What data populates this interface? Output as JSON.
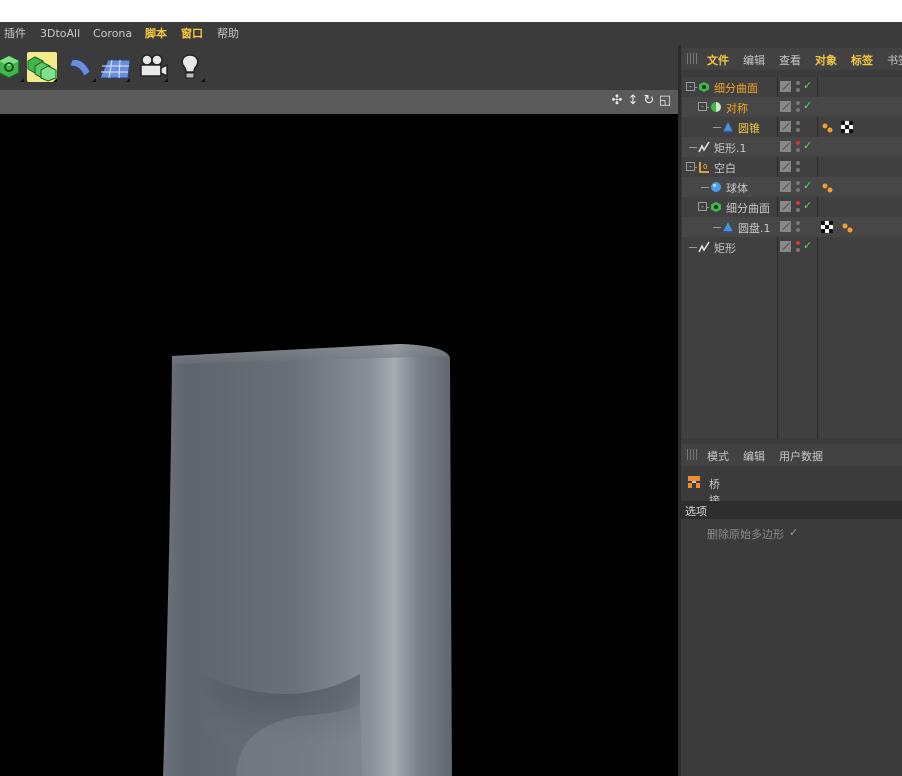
{
  "menubar": {
    "items": [
      {
        "label": "插件",
        "highlight": false
      },
      {
        "label": "3DtoAll",
        "highlight": false
      },
      {
        "label": "Corona",
        "highlight": false
      },
      {
        "label": "脚本",
        "highlight": true
      },
      {
        "label": "窗口",
        "highlight": true
      },
      {
        "label": "帮助",
        "highlight": false
      }
    ]
  },
  "toolbar": {
    "buttons": [
      {
        "icon": "subdivision-cube-icon"
      },
      {
        "icon": "array-cubes-icon",
        "active": true
      },
      {
        "icon": "bend-deformer-icon"
      },
      {
        "icon": "floor-plane-icon"
      },
      {
        "icon": "camera-icon"
      },
      {
        "icon": "light-bulb-icon"
      }
    ]
  },
  "viewport": {
    "header_icons": [
      "move-view-icon",
      "zoom-view-icon",
      "rotate-view-icon",
      "maximize-view-icon"
    ],
    "background": "#000000"
  },
  "object_manager": {
    "menus": [
      {
        "label": "文件",
        "highlight": true
      },
      {
        "label": "编辑",
        "highlight": false
      },
      {
        "label": "查看",
        "highlight": false
      },
      {
        "label": "对象",
        "highlight": true
      },
      {
        "label": "标签",
        "highlight": true
      },
      {
        "label": "书签",
        "highlight": false
      }
    ],
    "rows": [
      {
        "name": "细分曲面",
        "icon": "subdivision-surface-icon",
        "style": "sel",
        "check": true,
        "dot_red": false,
        "tags": []
      },
      {
        "name": "对称",
        "icon": "symmetry-icon",
        "style": "sel",
        "check": true,
        "dot_red": false,
        "tags": []
      },
      {
        "name": "圆锥",
        "icon": "cone-icon",
        "style": "sel2",
        "check": false,
        "dot_red": false,
        "tags": [
          "phong-tag-icon",
          "checker-tag-icon"
        ]
      },
      {
        "name": "矩形.1",
        "icon": "spline-icon",
        "style": "",
        "check": true,
        "dot_red": true,
        "tags": []
      },
      {
        "name": "空白",
        "icon": "null-icon",
        "style": "",
        "check": false,
        "dot_red": false,
        "tags": []
      },
      {
        "name": "球体",
        "icon": "sphere-icon",
        "style": "",
        "check": true,
        "dot_red": false,
        "tags": [
          "phong-tag-icon"
        ]
      },
      {
        "name": "细分曲面",
        "icon": "subdivision-surface-icon",
        "style": "",
        "check": true,
        "dot_red": true,
        "tags": []
      },
      {
        "name": "圆盘.1",
        "icon": "disc-icon",
        "style": "",
        "check": false,
        "dot_red": false,
        "tags": [
          "checker-tag-icon",
          "phong-tag-icon"
        ]
      },
      {
        "name": "矩形",
        "icon": "spline-icon",
        "style": "",
        "check": true,
        "dot_red": true,
        "tags": []
      }
    ]
  },
  "attribute_manager": {
    "menus": [
      "模式",
      "编辑",
      "用户数据"
    ],
    "title": "桥接",
    "section": "选项",
    "option_label": "删除原始多边形",
    "option_check": "✓"
  },
  "colors": {
    "accent": "#f5c842",
    "selected": "#f5a623",
    "panel": "#3b3b3b",
    "check": "#5fd35f"
  }
}
